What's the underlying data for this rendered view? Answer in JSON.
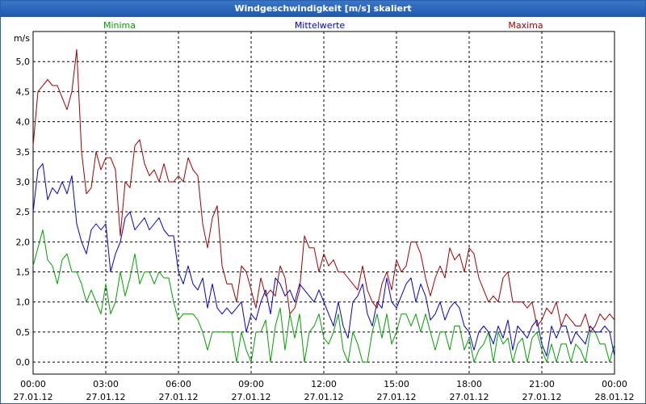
{
  "window": {
    "title": "Windgeschwindigkeit [m/s] skaliert"
  },
  "chart_data": {
    "type": "line",
    "title": "Windgeschwindigkeit [m/s] skaliert",
    "ylabel": "m/s",
    "xlabel": "",
    "ylim": [
      -0.2,
      5.5
    ],
    "xlim": [
      0,
      24
    ],
    "grid": true,
    "legend_placement": "top",
    "y_ticks": [
      "0,0",
      "0,5",
      "1,0",
      "1,5",
      "2,0",
      "2,5",
      "3,0",
      "3,5",
      "4,0",
      "4,5",
      "5,0"
    ],
    "x_ticks": [
      {
        "time": "00:00",
        "date": "27.01.12"
      },
      {
        "time": "03:00",
        "date": "27.01.12"
      },
      {
        "time": "06:00",
        "date": "27.01.12"
      },
      {
        "time": "09:00",
        "date": "27.01.12"
      },
      {
        "time": "12:00",
        "date": "27.01.12"
      },
      {
        "time": "15:00",
        "date": "27.01.12"
      },
      {
        "time": "18:00",
        "date": "27.01.12"
      },
      {
        "time": "21:00",
        "date": "27.01.12"
      },
      {
        "time": "00:00",
        "date": "28.01.12"
      }
    ],
    "series": [
      {
        "name": "Minima",
        "color": "#00a000",
        "x": [
          0,
          0.2,
          0.4,
          0.6,
          0.8,
          1.0,
          1.2,
          1.4,
          1.6,
          1.8,
          2.0,
          2.2,
          2.4,
          2.6,
          2.8,
          3.0,
          3.2,
          3.4,
          3.6,
          3.8,
          4.0,
          4.2,
          4.4,
          4.6,
          4.8,
          5.0,
          5.2,
          5.4,
          5.6,
          5.8,
          6.0,
          6.2,
          6.4,
          6.6,
          6.8,
          7.0,
          7.2,
          7.4,
          7.6,
          7.8,
          8.0,
          8.2,
          8.4,
          8.6,
          8.8,
          9.0,
          9.2,
          9.4,
          9.6,
          9.8,
          10.0,
          10.2,
          10.4,
          10.6,
          10.8,
          11.0,
          11.2,
          11.4,
          11.6,
          11.8,
          12.0,
          12.2,
          12.4,
          12.6,
          12.8,
          13.0,
          13.2,
          13.4,
          13.6,
          13.8,
          14.0,
          14.2,
          14.4,
          14.6,
          14.8,
          15.0,
          15.2,
          15.4,
          15.6,
          15.8,
          16.0,
          16.2,
          16.4,
          16.6,
          16.8,
          17.0,
          17.2,
          17.4,
          17.6,
          17.8,
          18.0,
          18.2,
          18.4,
          18.6,
          18.8,
          19.0,
          19.2,
          19.4,
          19.6,
          19.8,
          20.0,
          20.2,
          20.4,
          20.6,
          20.8,
          21.0,
          21.2,
          21.4,
          21.6,
          21.8,
          22.0,
          22.2,
          22.4,
          22.6,
          22.8,
          23.0,
          23.2,
          23.4,
          23.6,
          23.8,
          24.0
        ],
        "values": [
          1.6,
          1.9,
          2.2,
          1.7,
          1.6,
          1.3,
          1.7,
          1.8,
          1.5,
          1.5,
          1.3,
          1.0,
          1.2,
          1.0,
          0.8,
          1.3,
          0.8,
          1.0,
          1.5,
          1.1,
          1.4,
          1.8,
          1.3,
          1.5,
          1.5,
          1.3,
          1.5,
          1.4,
          1.4,
          1.0,
          0.7,
          0.8,
          0.8,
          0.8,
          0.7,
          0.5,
          0.2,
          0.5,
          0.5,
          0.5,
          0.5,
          0.5,
          0.0,
          0.5,
          0.2,
          0.0,
          0.5,
          0.5,
          0.7,
          0.0,
          0.6,
          0.9,
          0.2,
          0.8,
          0.4,
          0.8,
          0.0,
          0.5,
          0.6,
          0.8,
          0.4,
          0.3,
          0.5,
          0.8,
          0.2,
          0.0,
          0.5,
          0.3,
          0.0,
          0.0,
          0.5,
          0.8,
          0.4,
          0.8,
          0.3,
          0.5,
          0.8,
          0.8,
          0.6,
          0.8,
          0.5,
          0.8,
          0.5,
          0.2,
          0.5,
          0.5,
          0.2,
          0.6,
          0.6,
          0.2,
          0.4,
          0.0,
          0.2,
          0.3,
          0.5,
          0.0,
          0.5,
          0.3,
          0.4,
          0.0,
          0.3,
          0.4,
          0.0,
          0.4,
          0.5,
          0.2,
          0.0,
          0.3,
          0.0,
          0.3,
          0.3,
          0.0,
          0.3,
          0.2,
          0.0,
          0.5,
          0.5,
          0.3,
          0.3,
          0.0,
          0.3
        ]
      },
      {
        "name": "Mittelwerte",
        "color": "#0000c8",
        "x": [
          0,
          0.2,
          0.4,
          0.6,
          0.8,
          1.0,
          1.2,
          1.4,
          1.6,
          1.8,
          2.0,
          2.2,
          2.4,
          2.6,
          2.8,
          3.0,
          3.2,
          3.4,
          3.6,
          3.8,
          4.0,
          4.2,
          4.4,
          4.6,
          4.8,
          5.0,
          5.2,
          5.4,
          5.6,
          5.8,
          6.0,
          6.2,
          6.4,
          6.6,
          6.8,
          7.0,
          7.2,
          7.4,
          7.6,
          7.8,
          8.0,
          8.2,
          8.4,
          8.6,
          8.8,
          9.0,
          9.2,
          9.4,
          9.6,
          9.8,
          10.0,
          10.2,
          10.4,
          10.6,
          10.8,
          11.0,
          11.2,
          11.4,
          11.6,
          11.8,
          12.0,
          12.2,
          12.4,
          12.6,
          12.8,
          13.0,
          13.2,
          13.4,
          13.6,
          13.8,
          14.0,
          14.2,
          14.4,
          14.6,
          14.8,
          15.0,
          15.2,
          15.4,
          15.6,
          15.8,
          16.0,
          16.2,
          16.4,
          16.6,
          16.8,
          17.0,
          17.2,
          17.4,
          17.6,
          17.8,
          18.0,
          18.2,
          18.4,
          18.6,
          18.8,
          19.0,
          19.2,
          19.4,
          19.6,
          19.8,
          20.0,
          20.2,
          20.4,
          20.6,
          20.8,
          21.0,
          21.2,
          21.4,
          21.6,
          21.8,
          22.0,
          22.2,
          22.4,
          22.6,
          22.8,
          23.0,
          23.2,
          23.4,
          23.6,
          23.8,
          24.0
        ],
        "values": [
          2.5,
          3.2,
          3.3,
          2.7,
          2.9,
          2.8,
          3.0,
          2.8,
          3.1,
          2.3,
          2.0,
          1.8,
          2.2,
          2.3,
          2.2,
          2.3,
          1.5,
          1.8,
          2.0,
          2.4,
          2.5,
          2.2,
          2.3,
          2.4,
          2.2,
          2.3,
          2.4,
          2.2,
          2.1,
          2.1,
          1.5,
          1.3,
          1.6,
          1.3,
          1.2,
          1.4,
          0.9,
          1.3,
          0.9,
          0.8,
          0.9,
          0.8,
          0.9,
          1.0,
          0.5,
          0.8,
          0.7,
          1.0,
          1.2,
          0.8,
          1.4,
          1.3,
          1.1,
          1.2,
          1.0,
          1.3,
          1.2,
          1.1,
          1.0,
          1.2,
          1.0,
          0.8,
          0.6,
          1.0,
          0.6,
          0.4,
          1.0,
          1.1,
          1.3,
          0.8,
          0.6,
          1.0,
          0.9,
          1.4,
          1.0,
          0.9,
          1.1,
          1.3,
          1.4,
          1.0,
          1.3,
          1.1,
          0.7,
          0.8,
          1.0,
          0.7,
          0.9,
          1.0,
          0.9,
          0.6,
          0.5,
          0.2,
          0.5,
          0.6,
          0.5,
          0.3,
          0.6,
          0.4,
          0.7,
          0.2,
          0.6,
          0.5,
          0.4,
          0.6,
          0.7,
          0.3,
          0.1,
          0.6,
          0.4,
          0.6,
          0.6,
          0.3,
          0.5,
          0.4,
          0.3,
          0.6,
          0.5,
          0.5,
          0.6,
          0.5,
          0.1
        ]
      },
      {
        "name": "Maxima",
        "color": "#a00000",
        "x": [
          0,
          0.2,
          0.4,
          0.6,
          0.8,
          1.0,
          1.2,
          1.4,
          1.6,
          1.8,
          2.0,
          2.2,
          2.4,
          2.6,
          2.8,
          3.0,
          3.2,
          3.4,
          3.6,
          3.8,
          4.0,
          4.2,
          4.4,
          4.6,
          4.8,
          5.0,
          5.2,
          5.4,
          5.6,
          5.8,
          6.0,
          6.2,
          6.4,
          6.6,
          6.8,
          7.0,
          7.2,
          7.4,
          7.6,
          7.8,
          8.0,
          8.2,
          8.4,
          8.6,
          8.8,
          9.0,
          9.2,
          9.4,
          9.6,
          9.8,
          10.0,
          10.2,
          10.4,
          10.6,
          10.8,
          11.0,
          11.2,
          11.4,
          11.6,
          11.8,
          12.0,
          12.2,
          12.4,
          12.6,
          12.8,
          13.0,
          13.2,
          13.4,
          13.6,
          13.8,
          14.0,
          14.2,
          14.4,
          14.6,
          14.8,
          15.0,
          15.2,
          15.4,
          15.6,
          15.8,
          16.0,
          16.2,
          16.4,
          16.6,
          16.8,
          17.0,
          17.2,
          17.4,
          17.6,
          17.8,
          18.0,
          18.2,
          18.4,
          18.6,
          18.8,
          19.0,
          19.2,
          19.4,
          19.6,
          19.8,
          20.0,
          20.2,
          20.4,
          20.6,
          20.8,
          21.0,
          21.2,
          21.4,
          21.6,
          21.8,
          22.0,
          22.2,
          22.4,
          22.6,
          22.8,
          23.0,
          23.2,
          23.4,
          23.6,
          23.8,
          24.0
        ],
        "values": [
          3.6,
          4.5,
          4.6,
          4.7,
          4.6,
          4.6,
          4.4,
          4.2,
          4.5,
          5.2,
          3.5,
          2.8,
          2.9,
          3.5,
          3.2,
          3.4,
          3.4,
          3.2,
          2.1,
          3.0,
          2.9,
          3.6,
          3.7,
          3.3,
          3.1,
          3.2,
          3.0,
          3.3,
          3.0,
          3.0,
          3.1,
          3.0,
          3.4,
          3.2,
          3.1,
          2.3,
          1.9,
          2.4,
          2.6,
          1.6,
          1.3,
          1.3,
          1.0,
          1.6,
          1.5,
          1.2,
          0.9,
          1.4,
          1.1,
          1.2,
          1.1,
          1.6,
          1.4,
          0.8,
          0.9,
          1.2,
          2.1,
          1.9,
          1.9,
          1.5,
          1.8,
          1.6,
          1.7,
          1.5,
          1.5,
          1.4,
          1.3,
          1.2,
          1.6,
          1.2,
          1.0,
          0.9,
          1.3,
          1.5,
          1.2,
          1.7,
          1.5,
          1.6,
          2.0,
          2.0,
          1.8,
          1.4,
          1.1,
          1.4,
          1.6,
          1.4,
          1.9,
          1.7,
          1.8,
          1.5,
          1.9,
          1.8,
          1.4,
          1.2,
          1.0,
          1.1,
          1.0,
          1.4,
          1.5,
          1.0,
          1.0,
          1.0,
          0.9,
          1.0,
          0.6,
          0.7,
          0.9,
          0.8,
          1.0,
          0.6,
          0.8,
          0.7,
          0.6,
          0.6,
          0.8,
          0.5,
          0.6,
          0.8,
          0.7,
          0.8,
          0.7
        ]
      }
    ]
  }
}
